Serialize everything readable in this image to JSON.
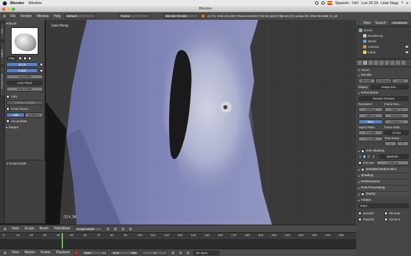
{
  "menubar": {
    "app": "Blender",
    "window": "Window",
    "status_right": [
      "Spanish - ISO",
      "Lun 20:29",
      "Lilak Nagy"
    ]
  },
  "window": {
    "title": "Blender"
  },
  "info": {
    "menus": [
      "File",
      "Render",
      "Window",
      "Help"
    ],
    "layout": "Default",
    "scene": "Scene",
    "engine": "Blender Render",
    "stats": "v2.73 | Verts:211,949 | Faces:313,548 | Tris:313,548 | Objects:1/3 | Lamps:0/1 | Mem:94.65M | k_3d"
  },
  "toolshelf": {
    "tabs": [
      "Tools",
      "Options",
      "Grease Pencil"
    ],
    "section_brush": "Brush",
    "brush_name": "Clay",
    "radius": "26 px",
    "strength": "0.500",
    "autosmooth": "Aut 0.000",
    "plane": "Area Plane",
    "plane_offset": "Plan 0.000",
    "trim": "Trim",
    "trim_value": "Distanc: 0.500",
    "front_faces": "Front Faces...",
    "add": "Add",
    "subtract": "Subtract",
    "accumulate": "Accumulate",
    "section_texture": "Texture",
    "mode_label": "Sculpt Mode"
  },
  "viewport": {
    "label": "User Persp",
    "object": "(1) k_3d"
  },
  "vp_header": {
    "menus": [
      "View",
      "Sculpt",
      "Brush",
      "Hide/Mask"
    ],
    "mode": "Sculpt Mode"
  },
  "timeline": {
    "ticks": [
      "0",
      "10",
      "20",
      "30",
      "40",
      "50",
      "60",
      "70",
      "80",
      "90",
      "100",
      "110",
      "120",
      "130",
      "140",
      "150",
      "160",
      "170",
      "180",
      "190",
      "200",
      "210",
      "220",
      "230",
      "240",
      "250"
    ],
    "menus": [
      "View",
      "Marker",
      "Frame",
      "Playback"
    ],
    "start": "Start:",
    "start_val": "1",
    "end": "End:",
    "end_val": "250",
    "current": "1",
    "sync": "No Sync"
  },
  "outliner": {
    "menus": [
      "View",
      "Search",
      "All Scenes"
    ],
    "items": [
      "Scene",
      "RenderLay",
      "World",
      "Camera",
      "Lamp"
    ]
  },
  "props": {
    "scene": "Scene",
    "render": "Render",
    "render_btns": [
      "Render",
      "Animation",
      "Audio"
    ],
    "display_label": "Display:",
    "display_val": "Image Edi...",
    "dimensions": "Dimensions",
    "presets": "Render Presets",
    "resolution": "Resolution:",
    "res_x": "1920 px",
    "res_y": "1080 px",
    "res_pct": "50%",
    "frame_range": "Frame Ran...",
    "start_f": "Start : 1",
    "end_f": "End:250",
    "step_f": "Frame: 1",
    "aspect": "Aspect Ratio:",
    "aspect_x": "X:1.000",
    "aspect_y": "Y:1.000",
    "frame_rate": "Frame Rate:",
    "fps": "24 fps",
    "time_remap": "Time Rema...",
    "remap_old": "1",
    "remap_new": "1",
    "aa": "Anti-Aliasing",
    "aa_samples": [
      "5",
      "8",
      "11",
      "16"
    ],
    "aa_filter": "Mitchell-...",
    "full_sample": "Full Sam",
    "aa_size": "1.000 px",
    "closed": [
      "Sampled Motion Blur",
      "Shading",
      "Performance",
      "Post Processing",
      "Stamp"
    ],
    "output": "Output",
    "output_path": "/tmp\\",
    "overwrite": "Overwrit",
    "file_ext": "File Exte",
    "placeholder": "Placehol",
    "cache": "Cache R"
  }
}
